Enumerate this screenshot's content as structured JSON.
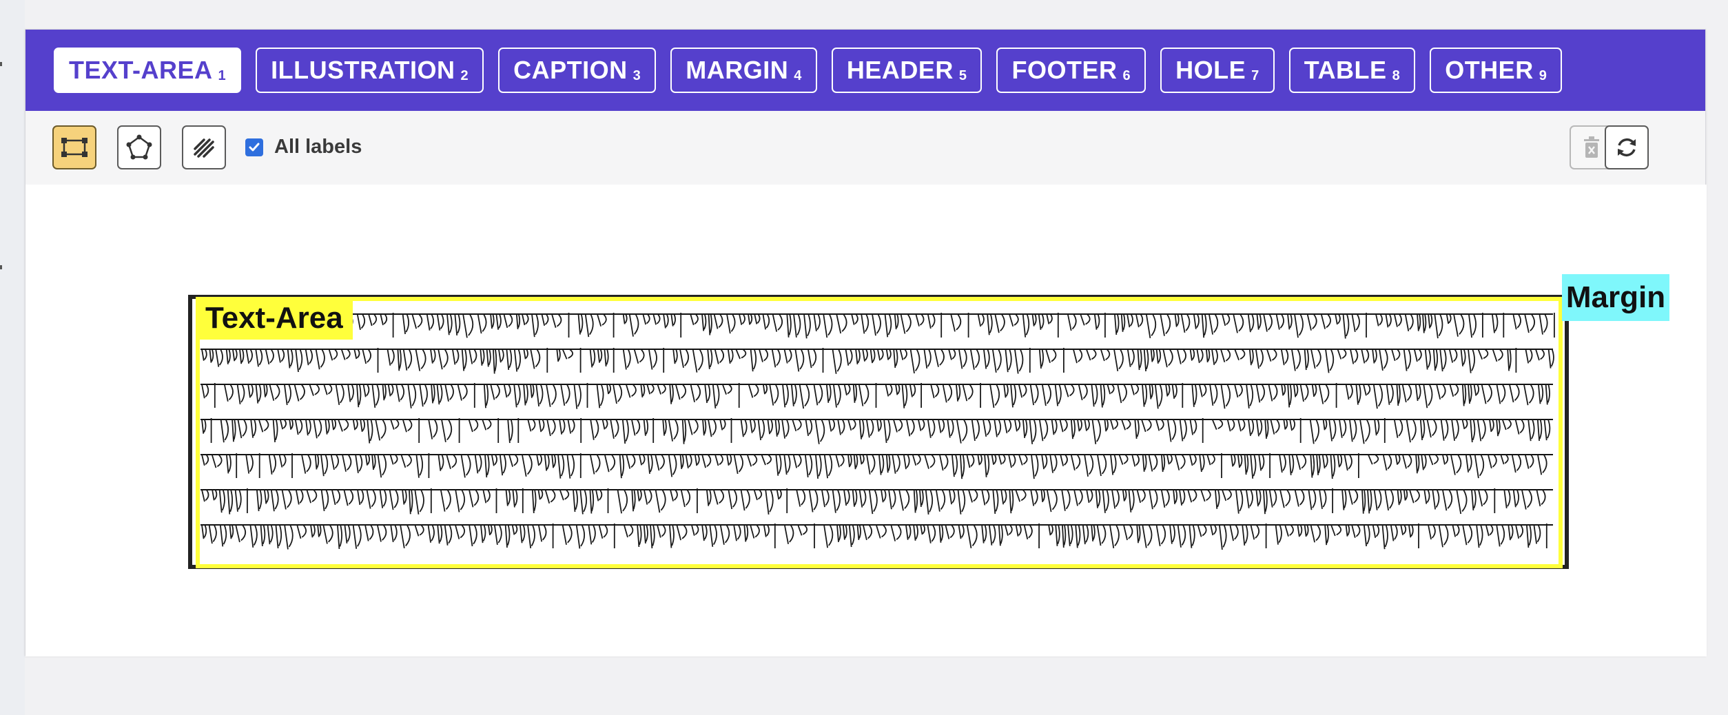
{
  "label_bar": {
    "buttons": [
      {
        "label": "TEXT-AREA",
        "key": "1"
      },
      {
        "label": "ILLUSTRATION",
        "key": "2"
      },
      {
        "label": "CAPTION",
        "key": "3"
      },
      {
        "label": "MARGIN",
        "key": "4"
      },
      {
        "label": "HEADER",
        "key": "5"
      },
      {
        "label": "FOOTER",
        "key": "6"
      },
      {
        "label": "HOLE",
        "key": "7"
      },
      {
        "label": "TABLE",
        "key": "8"
      },
      {
        "label": "OTHER",
        "key": "9"
      }
    ],
    "active_index": 0
  },
  "toolbar": {
    "tools": [
      "rectangle-tool-icon",
      "polygon-tool-icon",
      "freehand-tool-icon"
    ],
    "active_tool": "rectangle-tool-icon",
    "all_labels": {
      "label": "All labels",
      "checked": true
    },
    "delete_disabled": true
  },
  "canvas": {
    "annotations": [
      {
        "label": "Text-Area",
        "color": "#ffff3b"
      },
      {
        "label": "Margin",
        "color": "#7ff7fb"
      }
    ]
  },
  "colors": {
    "accent": "#5540cc",
    "active_tool": "#f6d27c",
    "checkbox": "#2f6fde"
  }
}
